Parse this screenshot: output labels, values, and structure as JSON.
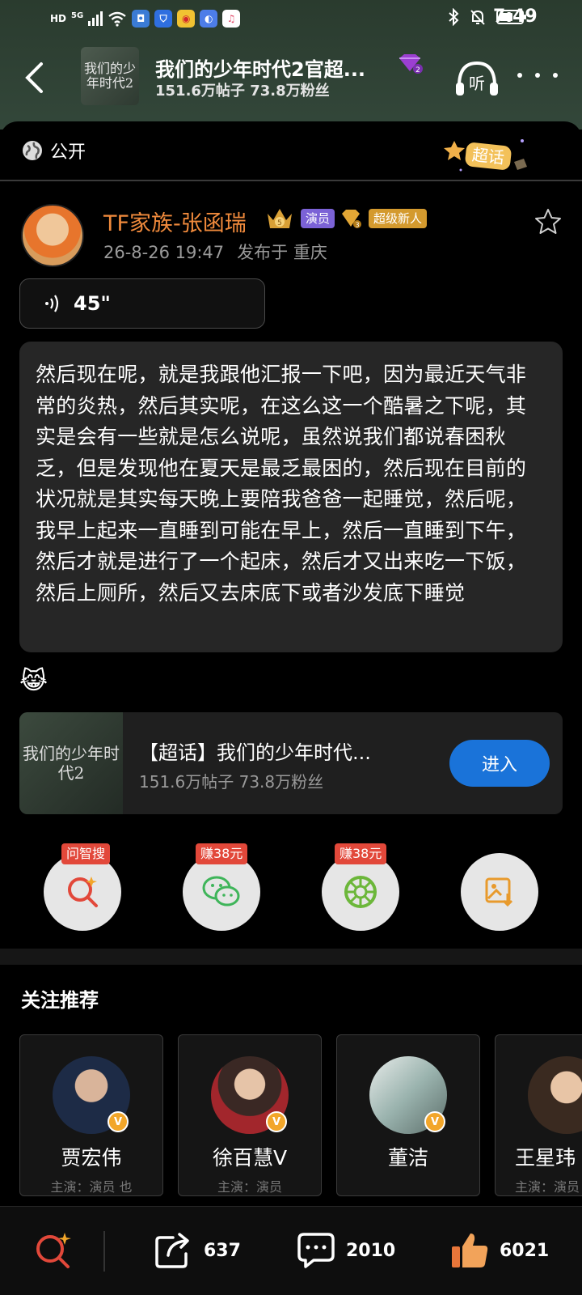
{
  "status_bar": {
    "network_tag": "HD",
    "signal_tag": "5G",
    "time": "7:49"
  },
  "header": {
    "title": "我们的少年时代2官超...",
    "subtitle": "151.6万帖子 73.8万粉丝",
    "listen_label": "听",
    "thumb_text": "我们的少年时代2"
  },
  "sheet": {
    "visibility_label": "公开",
    "chaohua_mark": "超话"
  },
  "post": {
    "author": "TF家族-张函瑞",
    "actor_tag": "演员",
    "newbie_tag": "超级新人",
    "timestamp": "26-8-26 19:47",
    "location": "发布于 重庆",
    "voice_duration": "45\"",
    "transcript": "然后现在呢，就是我跟他汇报一下吧，因为最近天气非常的炎热，然后其实呢，在这么这一个酷暑之下呢，其实是会有一些就是怎么说呢，虽然说我们都说春困秋乏，但是发现他在夏天是最乏最困的，然后现在目前的状况就是其实每天晚上要陪我爸爸一起睡觉，然后呢，我早上起来一直睡到可能在早上，然后一直睡到下午，然后才就是进行了一个起床，然后才又出来吃一下饭，然后上厕所，然后又去床底下或者沙发底下睡觉",
    "emoji": "😹"
  },
  "topic_card": {
    "title": "【超话】我们的少年时代...",
    "subtitle": "151.6万帖子 73.8万粉丝",
    "enter_label": "进入",
    "thumb_text": "我们的少年时代2"
  },
  "share": {
    "items": [
      {
        "tag": "问智搜",
        "icon": "smart-search-icon"
      },
      {
        "tag": "赚38元",
        "icon": "wechat-icon"
      },
      {
        "tag": "赚38元",
        "icon": "moments-icon"
      },
      {
        "tag": "",
        "icon": "save-image-icon"
      }
    ]
  },
  "recommend": {
    "title": "关注推荐",
    "users": [
      {
        "name": "贾宏伟",
        "desc": "主演：演员 也"
      },
      {
        "name": "徐百慧V",
        "desc": "主演：演员"
      },
      {
        "name": "董洁",
        "desc": ""
      },
      {
        "name": "王星玮",
        "desc": "主演：演员"
      }
    ]
  },
  "bottom_bar": {
    "repost_count": "637",
    "comment_count": "2010",
    "like_count": "6021"
  },
  "colors": {
    "author_orange": "#f08a3c",
    "enter_blue": "#1a73d9",
    "actor_tag_purple": "#7b62d6",
    "newbie_tag_gold": "#d49a2e",
    "header_green": "#2f4233"
  }
}
